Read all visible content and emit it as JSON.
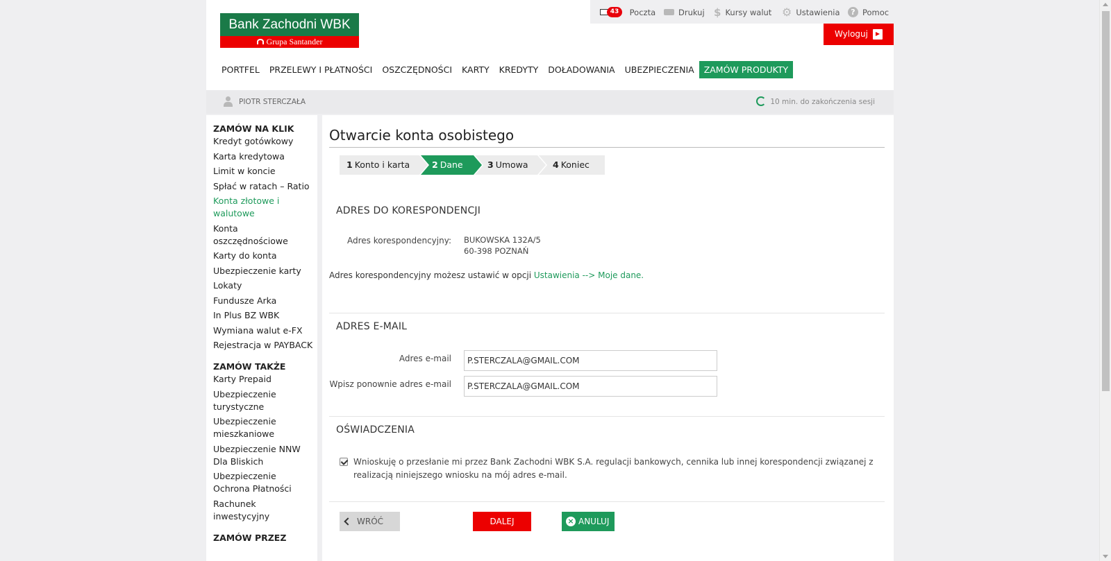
{
  "logo": {
    "name": "Bank Zachodni WBK",
    "group": "Grupa Santander"
  },
  "colors": {
    "brand_green": "#1e9a5b",
    "brand_red": "#ec0000",
    "logo_green": "#1a7a48"
  },
  "toolbar": {
    "mail_label": "Poczta",
    "mail_count": "43",
    "print_label": "Drukuj",
    "fx_label": "Kursy walut",
    "settings_label": "Ustawienia",
    "help_label": "Pomoc",
    "logout_label": "Wyloguj"
  },
  "nav": {
    "items": [
      "PORTFEL",
      "PRZELEWY I PŁATNOŚCI",
      "OSZCZĘDNOŚCI",
      "KARTY",
      "KREDYTY",
      "DOŁADOWANIA",
      "UBEZPIECZENIA",
      "ZAMÓW PRODUKTY"
    ],
    "active": "ZAMÓW PRODUKTY"
  },
  "user": {
    "name": "PIOTR STERCZAŁA",
    "session": "10 min. do zakończenia sesji"
  },
  "sidebar": {
    "section1": "ZAMÓW NA KLIK",
    "items1": [
      "Kredyt gotówkowy",
      "Karta kredytowa",
      "Limit w koncie",
      "Spłać w ratach – Ratio",
      "Konta złotowe i walutowe",
      "Konta oszczędnościowe",
      "Karty do konta",
      "Ubezpieczenie karty",
      "Lokaty",
      "Fundusze Arka",
      "In Plus BZ WBK",
      "Wymiana walut e-FX",
      "Rejestracja w PAYBACK"
    ],
    "active": "Konta złotowe i walutowe",
    "section2": "ZAMÓW TAKŻE",
    "items2": [
      "Karty Prepaid",
      "Ubezpieczenie turystyczne",
      "Ubezpieczenie mieszkaniowe",
      "Ubezpieczenie NNW Dla Bliskich",
      "Ubezpieczenie Ochrona Płatności",
      "Rachunek inwestycyjny"
    ],
    "section3": "ZAMÓW PRZEZ"
  },
  "main": {
    "title": "Otwarcie konta osobistego",
    "steps": [
      {
        "num": "1",
        "label": "Konto i karta"
      },
      {
        "num": "2",
        "label": "Dane"
      },
      {
        "num": "3",
        "label": "Umowa"
      },
      {
        "num": "4",
        "label": "Koniec"
      }
    ],
    "active_step": 2,
    "address": {
      "heading": "ADRES DO KORESPONDENCJI",
      "label": "Adres korespondencyjny:",
      "line1": "BUKOWSKA 132A/5",
      "line2": "60-398 POZNAŃ",
      "note_text": "Adres korespondencyjny możesz ustawić w opcji ",
      "note_link": "Ustawienia --> Moje dane."
    },
    "email": {
      "heading": "ADRES E-MAIL",
      "label1": "Adres e-mail",
      "value1": "P.STERCZALA@GMAIL.COM",
      "label2": "Wpisz ponownie adres e-mail",
      "value2": "P.STERCZALA@GMAIL.COM"
    },
    "declarations": {
      "heading": "OŚWIADCZENIA",
      "checked": true,
      "text": "Wnioskuję o przesłanie mi przez Bank Zachodni WBK S.A. regulacji bankowych, cennika lub innej korespondencji związanej z realizacją niniejszego wniosku na mój adres e-mail."
    },
    "buttons": {
      "back": "WRÓĆ",
      "next": "DALEJ",
      "cancel": "ANULUJ"
    }
  }
}
